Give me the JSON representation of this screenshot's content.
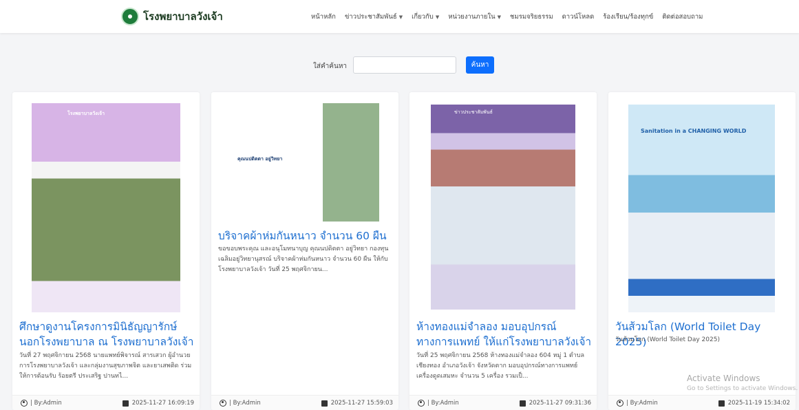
{
  "nav": {
    "brand": "โรงพยาบาลวังเจ้า",
    "items": [
      {
        "label": "หน้าหลัก",
        "dropdown": false
      },
      {
        "label": "ข่าวประชาสัมพันธ์",
        "dropdown": true
      },
      {
        "label": "เกี่ยวกับ",
        "dropdown": true
      },
      {
        "label": "หน่วยงานภายใน",
        "dropdown": true
      },
      {
        "label": "ชมรมจริยธรรม",
        "dropdown": false
      },
      {
        "label": "ดาวน์โหลด",
        "dropdown": false
      },
      {
        "label": "ร้องเรียน/ร้องทุกข์",
        "dropdown": false
      },
      {
        "label": "ติดต่อสอบถาม",
        "dropdown": false
      }
    ]
  },
  "search": {
    "label": "ใส่คำค้นหา",
    "value": "",
    "button": "ค้นหา"
  },
  "cards": [
    {
      "title": "ศึกษาดูงานโครงการมินิธัญญารักษ์นอกโรงพยาบาล ณ โรงพยาบาลวังเจ้า",
      "excerpt": "วันที่ 27 พฤศจิกายน 2568 นายแพทย์พิจารณ์ สารเสวก ผู้อำนวยการโรงพยาบาลวังเจ้า และกลุ่มงานสุขภาพจิต และยาเสพติด ร่วมให้การต้อนรับ ร้อยตรี ประเสริฐ ปานทไ...",
      "author": "| By:Admin",
      "date": "2025-11-27 16:09:19",
      "image_text": "โรงพยาบาลวังเจ้า"
    },
    {
      "title": "บริจาคผ้าห่มกันหนาว จำนวน 60 ผืน",
      "excerpt": "ขอขอบพระคุณ และอนุโมทนาบุญ คุณนปดิตตา อยู่วิทยา กองทุนเฉลิมอยู่วิทยานุสรณ์ บริจาคผ้าห่มกันหนาว จำนวน 60 ผืน ให้กับโรงพยาบาลวังเจ้า วันที่ 25 พฤศจิกายน...",
      "author": "| By:Admin",
      "date": "2025-11-27 15:59:03",
      "image_text": "คุณนปดิตตา อยู่วิทยา"
    },
    {
      "title": "ห้างทองแม่จำลอง มอบอุปกรณ์ทางการแพทย์ ให้แก่โรงพยาบาลวังเจ้า",
      "excerpt": "วันที่ 25 พฤศจิกายน 2568 ห้างทองแม่จำลอง 604 หมู่ 1 ตำบลเชียงทอง อำเภอวังเจ้า จังหวัดตาก มอบอุปกรณ์ทางการแพทย์ เครื่องดูดเสมหะ จำนวน 5 เครื่อง รวมเป็...",
      "author": "| By:Admin",
      "date": "2025-11-27 09:31:36",
      "image_text": "ข่าวประชาสัมพันธ์"
    },
    {
      "title": "วันส้วมโลก (World Toilet Day 2025)",
      "excerpt": "วันส้วมโลก (World Toilet Day 2025)",
      "author": "| By:Admin",
      "date": "2025-11-19 15:34:02",
      "image_text": "Sanitation in a CHANGING WORLD"
    }
  ],
  "watermark": {
    "line1": "Activate Windows",
    "line2": "Go to Settings to activate Windows."
  }
}
